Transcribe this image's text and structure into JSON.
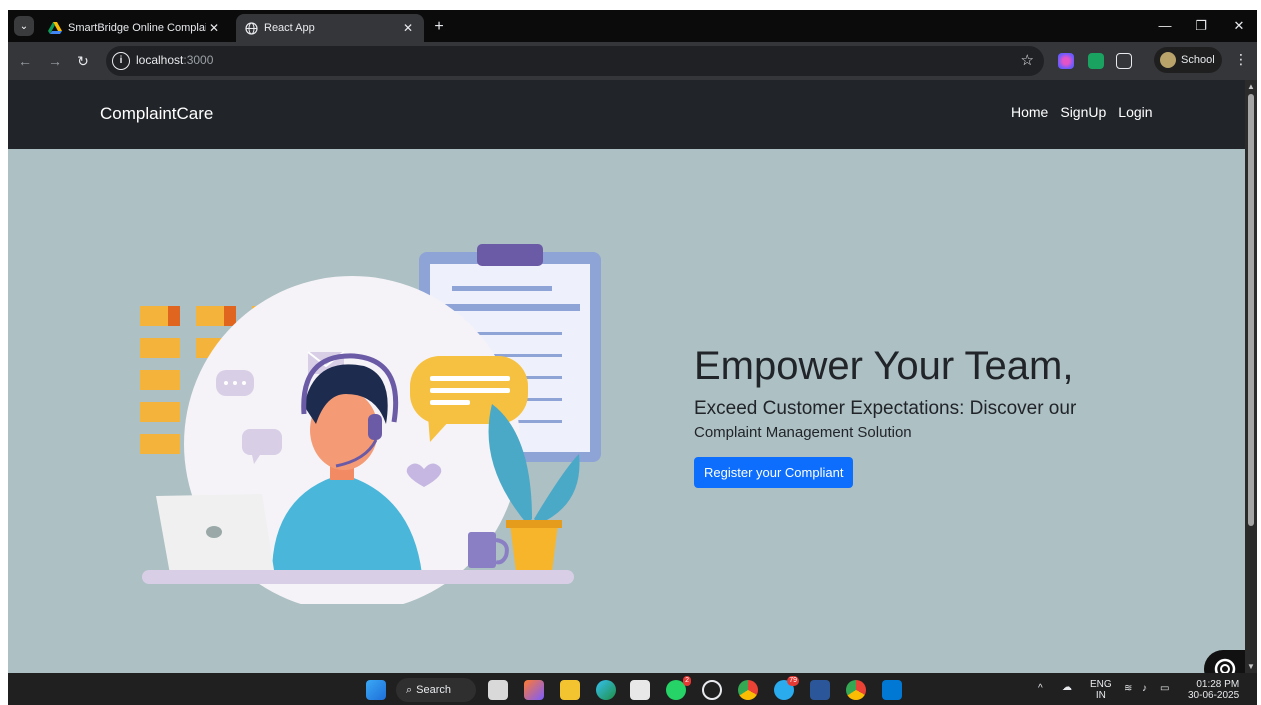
{
  "browser": {
    "tabs": [
      {
        "title": "SmartBridge Online Complaints",
        "active": false
      },
      {
        "title": "React App",
        "active": true
      }
    ],
    "new_tab_label": "+",
    "address": {
      "host": "localhost",
      "path": ":3000"
    },
    "profile_label": "School"
  },
  "app": {
    "brand": "ComplaintCare",
    "nav_links": [
      "Home",
      "SignUp",
      "Login"
    ],
    "hero": {
      "heading": "Empower Your Team,",
      "lead": "Exceed Customer Expectations: Discover our",
      "sub": "Complaint Management Solution",
      "cta_label": "Register your Compliant"
    }
  },
  "taskbar": {
    "search_label": "Search",
    "whatsapp_badge": "2",
    "telegram_badge": "79",
    "language": "ENG",
    "region": "IN",
    "time": "01:28 PM",
    "date": "30-06-2025"
  },
  "colors": {
    "page_bg": "#adc0c4",
    "navbar_bg": "#212529",
    "cta_bg": "#0d6efd"
  }
}
